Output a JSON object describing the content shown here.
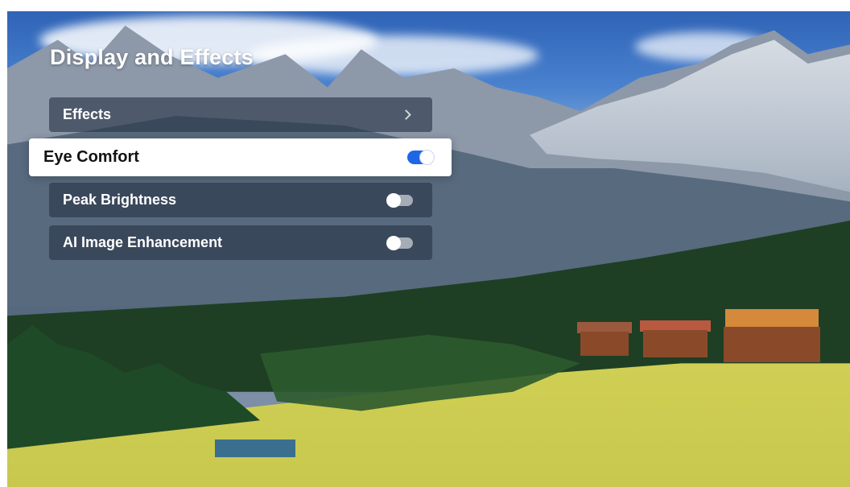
{
  "panel": {
    "title": "Display and Effects"
  },
  "settings": [
    {
      "label": "Effects",
      "control": "chevron-right-icon"
    },
    {
      "label": "Eye Comfort",
      "control": "toggle",
      "state": "on",
      "focused": true
    },
    {
      "label": "Peak Brightness",
      "control": "toggle",
      "state": "off"
    },
    {
      "label": "AI Image Enhancement",
      "control": "toggle",
      "state": "off"
    }
  ],
  "colors": {
    "toggle_on": "#1f66e6",
    "focused_row": "#ffffff",
    "row_background": "rgba(40,52,70,0.62)"
  }
}
